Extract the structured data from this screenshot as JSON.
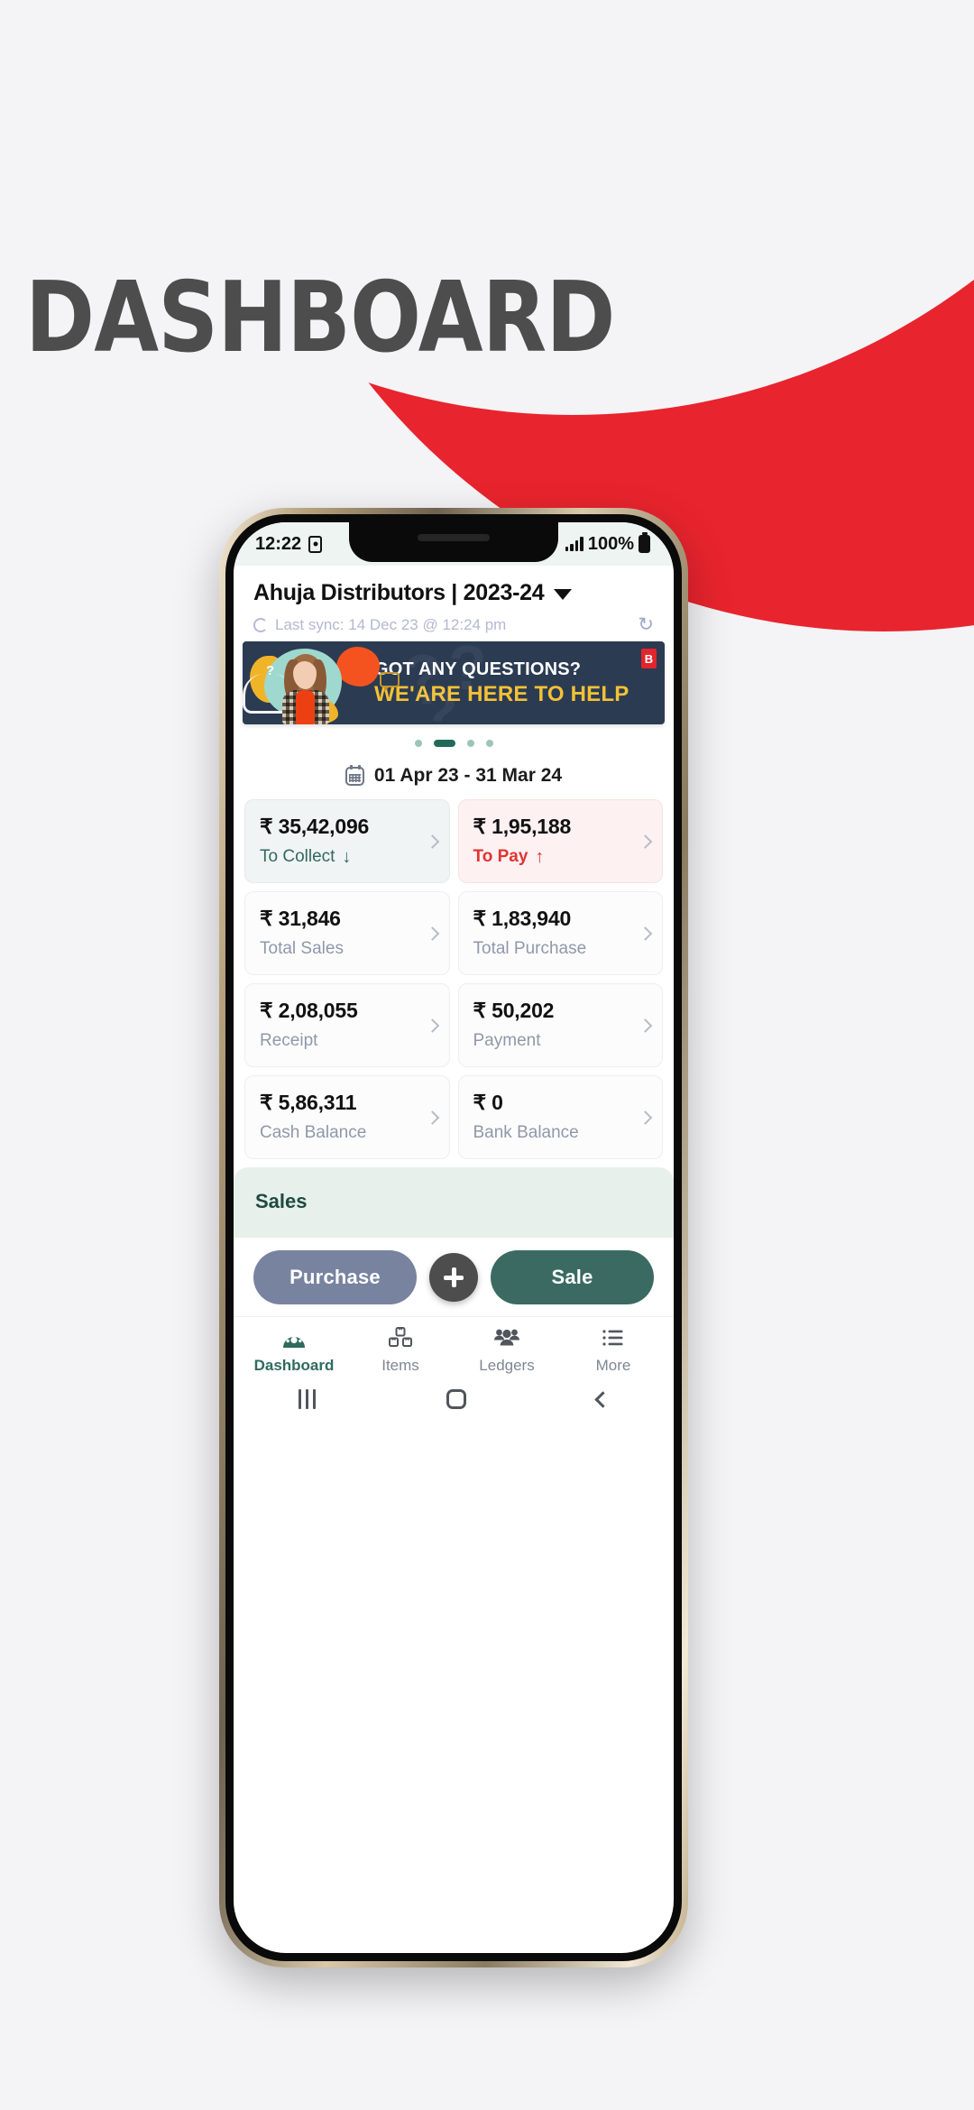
{
  "poster": {
    "headline": "DASHBOARD",
    "accent_red": "#e8242e",
    "background": "#f4f3f5"
  },
  "status_bar": {
    "time": "12:22",
    "alarm_icon": "alarm-icon",
    "signal_icon": "signal-bars-icon",
    "battery_percent": "100%",
    "battery_icon": "battery-full-icon"
  },
  "header": {
    "company": "Ahuja Distributors | 2023-24",
    "dropdown_icon": "chevron-down-icon",
    "sync_text": "Last sync: 14 Dec 23 @ 12:24 pm",
    "sync_spinner_icon": "loading-spinner-icon",
    "refresh_icon": "refresh-icon",
    "refresh_glyph": "↻"
  },
  "banner": {
    "line1": "GOT ANY QUESTIONS?",
    "line2": "WE'ARE HERE TO HELP",
    "badge": "B",
    "chat_icon": "chat-bubble-icon",
    "person_icon": "person-illustration",
    "question_mark": "?",
    "ghost_q1": "?",
    "ghost_q2": "?",
    "ghost_q3": "?",
    "bg_color": "#2b3b52",
    "line2_color": "#f3c136"
  },
  "carousel": {
    "total": 4,
    "active_index": 1,
    "active_color": "#22695a",
    "inactive_color": "#9dc4b8"
  },
  "date_range": {
    "calendar_icon": "calendar-icon",
    "label": "01 Apr 23 - 31 Mar 24"
  },
  "metrics": [
    [
      {
        "value": "₹ 35,42,096",
        "label": "To Collect",
        "arrow": "↓",
        "style": "collect",
        "label_class": "teal",
        "chevron_icon": "chevron-right-icon"
      },
      {
        "value": "₹ 1,95,188",
        "label": "To Pay",
        "arrow": "↑",
        "style": "pay",
        "label_class": "red",
        "chevron_icon": "chevron-right-icon"
      }
    ],
    [
      {
        "value": "₹ 31,846",
        "label": "Total Sales",
        "arrow": "",
        "style": "",
        "label_class": "",
        "chevron_icon": "chevron-right-icon"
      },
      {
        "value": "₹ 1,83,940",
        "label": "Total Purchase",
        "arrow": "",
        "style": "",
        "label_class": "",
        "chevron_icon": "chevron-right-icon"
      }
    ],
    [
      {
        "value": "₹ 2,08,055",
        "label": "Receipt",
        "arrow": "",
        "style": "",
        "label_class": "",
        "chevron_icon": "chevron-right-icon"
      },
      {
        "value": "₹ 50,202",
        "label": "Payment",
        "arrow": "",
        "style": "",
        "label_class": "",
        "chevron_icon": "chevron-right-icon"
      }
    ],
    [
      {
        "value": "₹ 5,86,311",
        "label": "Cash Balance",
        "arrow": "",
        "style": "",
        "label_class": "",
        "chevron_icon": "chevron-right-icon"
      },
      {
        "value": "₹ 0",
        "label": "Bank Balance",
        "arrow": "",
        "style": "",
        "label_class": "",
        "chevron_icon": "chevron-right-icon"
      }
    ]
  ],
  "sales_section": {
    "title": "Sales",
    "bg_color": "#e8f0ec"
  },
  "actions": {
    "purchase_label": "Purchase",
    "purchase_color": "#78839f",
    "add_icon": "plus-icon",
    "sale_label": "Sale",
    "sale_color": "#3a6a62"
  },
  "bottom_nav": {
    "active_color": "#2e6b5e",
    "items": [
      {
        "label": "Dashboard",
        "icon": "dashboard-gauge-icon",
        "active": true
      },
      {
        "label": "Items",
        "icon": "boxes-icon",
        "active": false
      },
      {
        "label": "Ledgers",
        "icon": "people-icon",
        "active": false
      },
      {
        "label": "More",
        "icon": "list-menu-icon",
        "active": false
      }
    ]
  },
  "android_nav": {
    "recent_icon": "recent-apps-icon",
    "home_icon": "home-icon",
    "back_icon": "back-icon"
  }
}
